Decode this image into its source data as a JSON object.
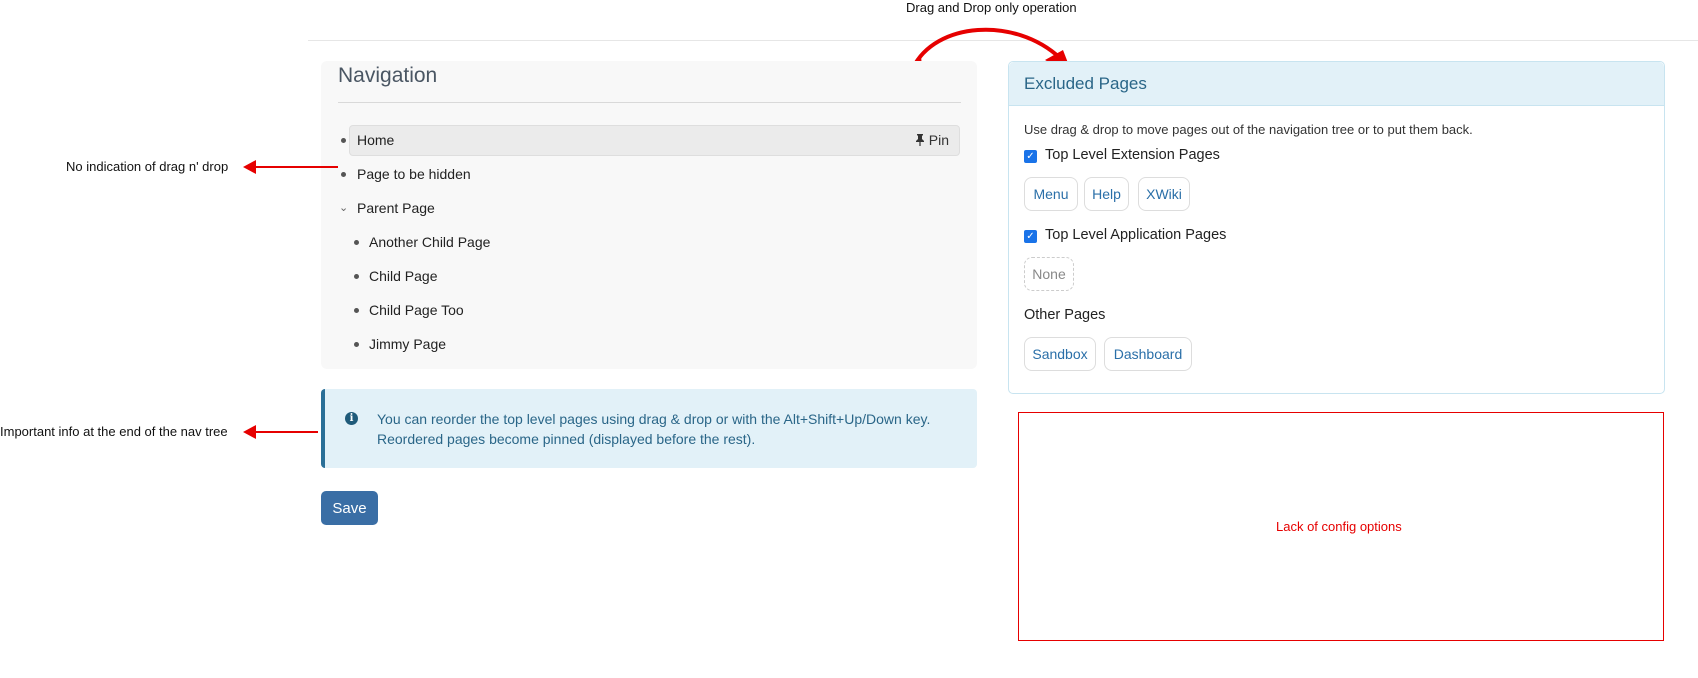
{
  "annotations": {
    "drag_drop": "Drag and Drop only operation",
    "no_indication": "No indication of drag n' drop",
    "important_info": "Important info at the end of the nav tree",
    "lack_config": "Lack of config options"
  },
  "navigation": {
    "title": "Navigation",
    "pin_label": "Pin",
    "items": [
      {
        "label": "Home"
      },
      {
        "label": "Page to be hidden"
      },
      {
        "label": "Parent Page"
      }
    ],
    "children": [
      {
        "label": "Another Child Page"
      },
      {
        "label": "Child Page"
      },
      {
        "label": "Child Page Too"
      },
      {
        "label": "Jimmy Page"
      }
    ]
  },
  "info": {
    "text": "You can reorder the top level pages using drag & drop or with the Alt+Shift+Up/Down key. Reordered pages become pinned (displayed before the rest)."
  },
  "save_label": "Save",
  "excluded": {
    "title": "Excluded Pages",
    "description": "Use drag & drop to move pages out of the navigation tree or to put them back.",
    "extension": {
      "label": "Top Level Extension Pages",
      "checked": true,
      "pages": [
        "Menu",
        "Help",
        "XWiki"
      ]
    },
    "application": {
      "label": "Top Level Application Pages",
      "checked": true,
      "empty_label": "None"
    },
    "other": {
      "label": "Other Pages",
      "pages": [
        "Sandbox",
        "Dashboard"
      ]
    }
  },
  "colors": {
    "annotation_red": "#e60000",
    "accent_blue": "#3a6ea5",
    "info_bg": "#e2f1f8"
  }
}
